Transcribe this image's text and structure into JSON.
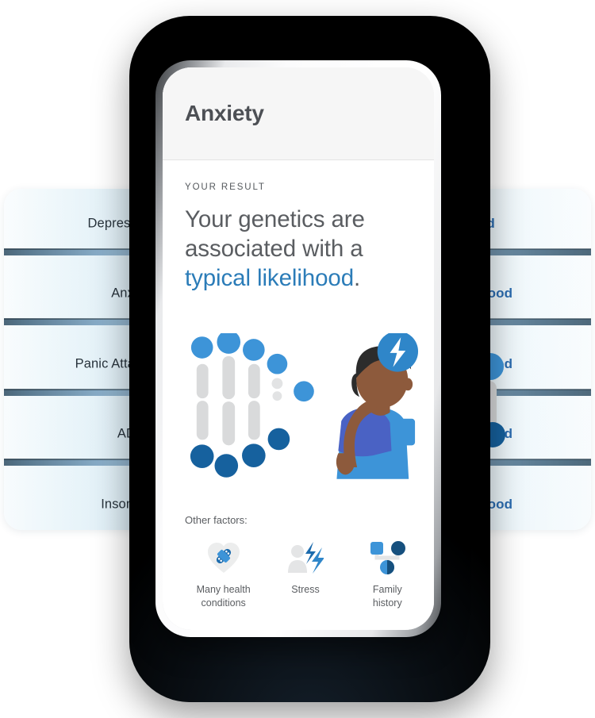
{
  "list_card": {
    "rows": [
      {
        "condition": "Depression",
        "likelihood": "Typical Likelihood"
      },
      {
        "condition": "Anxiety",
        "likelihood": "Increased Likelihood"
      },
      {
        "condition": "Panic Attacks",
        "likelihood": "Increased Likelihood"
      },
      {
        "condition": "ADHD",
        "likelihood": "Increased Likelihood"
      },
      {
        "condition": "Insomnia",
        "likelihood": "Increased Likelihood"
      }
    ]
  },
  "phone": {
    "header": {
      "title": "Anxiety"
    },
    "result": {
      "kicker": "YOUR RESULT",
      "line1": "Your genetics are",
      "line2": "associated with a",
      "highlight": "typical likelihood",
      "period": "."
    },
    "illustration": {
      "name": "dna-and-stressed-person-illustration",
      "bolt_badge": "lightning-bolt-icon"
    },
    "factors": {
      "title": "Other factors:",
      "items": [
        {
          "icon": "heart-bandage-icon",
          "label": "Many health\nconditions",
          "label_line1": "Many health",
          "label_line2": "conditions"
        },
        {
          "icon": "person-lightning-icon",
          "label": "Stress",
          "label_line1": "Stress",
          "label_line2": ""
        },
        {
          "icon": "family-tree-icon",
          "label": "Family history",
          "label_line1": "Family",
          "label_line2": "history"
        }
      ]
    }
  },
  "colors": {
    "accent_blue": "#2b7cb8",
    "label_blue": "#2b6cb0",
    "dna_light_blue": "#3d94d8",
    "dna_dark_blue": "#16619e",
    "dna_grey": "#d9dadb",
    "text_grey": "#5a5d61",
    "header_bg": "#f6f6f6",
    "plate_black": "#000000"
  }
}
